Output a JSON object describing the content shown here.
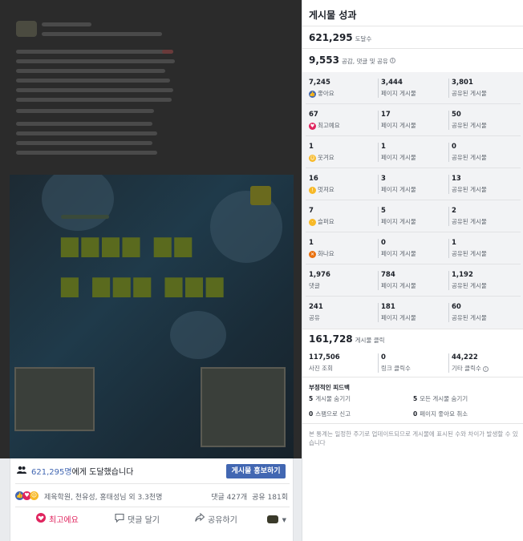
{
  "post": {
    "reach_count": "621,295명",
    "reach_suffix": "에게 도달했습니다",
    "boost_label": "게시물 홍보하기",
    "reactors": "제육학원, 천유성, 홍태성님 외 3.3천명",
    "comments": "댓글 427개",
    "shares": "공유 181회",
    "actions": {
      "love": "최고에요",
      "comment": "댓글 달기",
      "share": "공유하기"
    }
  },
  "perf": {
    "title": "게시물 성과",
    "reach": {
      "value": "621,295",
      "caption": "도달수"
    },
    "engagement": {
      "value": "9,553",
      "caption": "공감, 댓글 및 공유",
      "info_icon": "i"
    },
    "rows": [
      {
        "icon": "like",
        "icon_color": "#4267b2",
        "total": "7,245",
        "label": "좋아요",
        "page": "3,444",
        "page_label": "페이지 게시물",
        "shared": "3,801",
        "shared_label": "공유된 게시물"
      },
      {
        "icon": "love",
        "icon_color": "#e0245e",
        "total": "67",
        "label": "최고예요",
        "page": "17",
        "page_label": "페이지 게시물",
        "shared": "50",
        "shared_label": "공유된 게시물"
      },
      {
        "icon": "haha",
        "icon_color": "#f7b928",
        "total": "1",
        "label": "웃겨요",
        "page": "1",
        "page_label": "페이지 게시물",
        "shared": "0",
        "shared_label": "공유된 게시물"
      },
      {
        "icon": "wow",
        "icon_color": "#f7b928",
        "total": "16",
        "label": "멋져요",
        "page": "3",
        "page_label": "페이지 게시물",
        "shared": "13",
        "shared_label": "공유된 게시물"
      },
      {
        "icon": "sad",
        "icon_color": "#f7b928",
        "total": "7",
        "label": "슬퍼요",
        "page": "5",
        "page_label": "페이지 게시물",
        "shared": "2",
        "shared_label": "공유된 게시물"
      },
      {
        "icon": "angry",
        "icon_color": "#e9710f",
        "total": "1",
        "label": "화나요",
        "page": "0",
        "page_label": "페이지 게시물",
        "shared": "1",
        "shared_label": "공유된 게시물"
      },
      {
        "icon": "",
        "icon_color": "",
        "total": "1,976",
        "label": "댓글",
        "page": "784",
        "page_label": "페이지 게시물",
        "shared": "1,192",
        "shared_label": "공유된 게시물"
      },
      {
        "icon": "",
        "icon_color": "",
        "total": "241",
        "label": "공유",
        "page": "181",
        "page_label": "페이지 게시물",
        "shared": "60",
        "shared_label": "공유된 게시물"
      }
    ],
    "clicks": {
      "value": "161,728",
      "caption": "게시물 클릭"
    },
    "click_breakdown": [
      {
        "value": "117,506",
        "label": "사진 조회"
      },
      {
        "value": "0",
        "label": "링크 클릭수"
      },
      {
        "value": "44,222",
        "label": "기타 클릭수",
        "info_icon": "i"
      }
    ],
    "negative": {
      "title": "부정적인 피드백",
      "items": [
        {
          "count": "5",
          "label": "게시물 숨기기"
        },
        {
          "count": "5",
          "label": "모든 게시물 숨기기"
        },
        {
          "count": "0",
          "label": "스팸으로 신고"
        },
        {
          "count": "0",
          "label": "페이지 좋아요 취소"
        }
      ]
    },
    "note": "본 통계는 일정한 주기로 업데이트되므로 게시물에 표시된 수와 차이가 발생할 수 있습니다"
  }
}
